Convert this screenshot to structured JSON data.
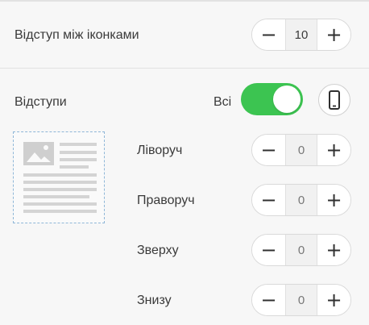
{
  "icon_spacing": {
    "label": "Відступ між іконками",
    "value": "10"
  },
  "paddings": {
    "label": "Відступи",
    "all_label": "Всі",
    "all_toggle_on": true,
    "mobile_icon": "mobile-phone-icon",
    "preview_icon": "text-image-layout-icon",
    "rows": [
      {
        "label": "Ліворуч",
        "value": "0"
      },
      {
        "label": "Праворуч",
        "value": "0"
      },
      {
        "label": "Зверху",
        "value": "0"
      },
      {
        "label": "Знизу",
        "value": "0"
      }
    ]
  },
  "stepper": {
    "minus": "−",
    "plus": "+"
  },
  "colors": {
    "toggle_on": "#3cc451",
    "preview_border": "#8fb7d8"
  }
}
